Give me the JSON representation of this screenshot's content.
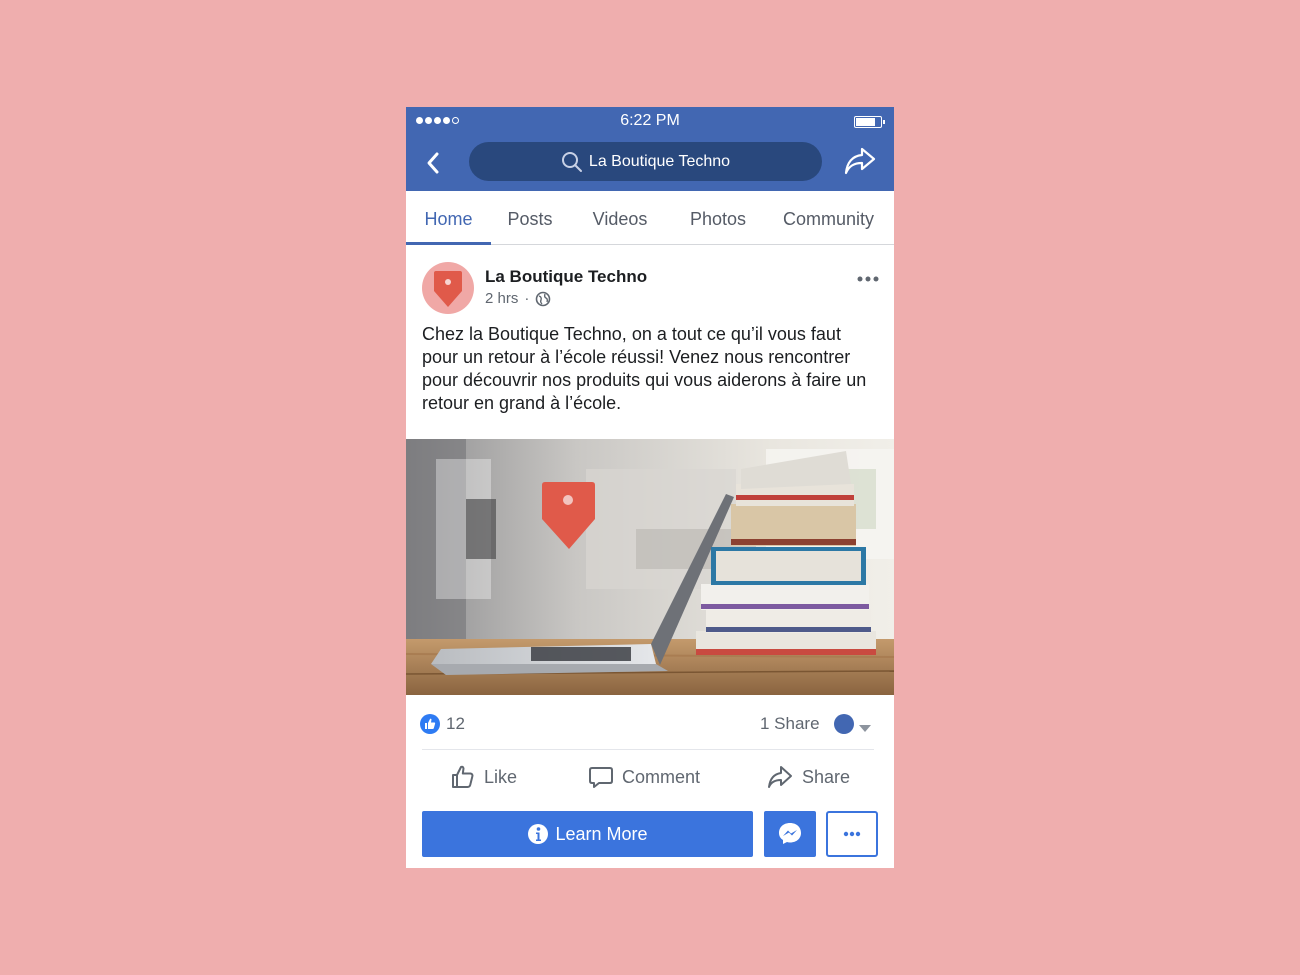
{
  "status_bar": {
    "time": "6:22 PM"
  },
  "navbar": {
    "search_text": "La Boutique Techno"
  },
  "tabs": [
    {
      "label": "Home",
      "active": true
    },
    {
      "label": "Posts"
    },
    {
      "label": "Videos"
    },
    {
      "label": "Photos"
    },
    {
      "label": "Community"
    }
  ],
  "post": {
    "page_name": "La Boutique Techno",
    "time": "2 hrs",
    "separator": "·",
    "text": "Chez la Boutique Techno, on a tout ce qu’il vous faut pour un retour à l’école réussi! Venez nous rencontrer pour découvrir nos produits qui vous aiderons à faire un retour en grand à l’école.",
    "likes": "12",
    "shares": "1 Share"
  },
  "actions": {
    "like": "Like",
    "comment": "Comment",
    "share": "Share"
  },
  "cta": {
    "learn_more": "Learn More"
  },
  "colors": {
    "background": "#efaeae",
    "brand_blue": "#4267b2",
    "button_blue": "#3b74dd",
    "logo_red": "#e05a4a"
  }
}
